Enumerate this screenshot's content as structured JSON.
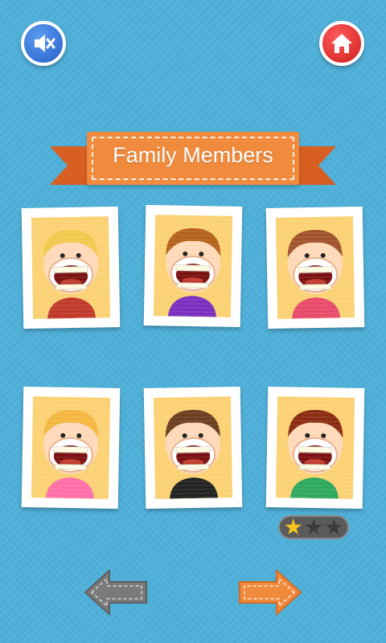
{
  "title": "Family Members",
  "buttons": {
    "sound": {
      "icon": "speaker-muted-icon",
      "color": "#1e58c6"
    },
    "home": {
      "icon": "home-icon",
      "color": "#d31f1f"
    }
  },
  "members": [
    {
      "id": "boy",
      "hair": "#f2c94c",
      "shirt": "#c0392b"
    },
    {
      "id": "big-brother",
      "hair": "#b4621b",
      "shirt": "#7b2fbf"
    },
    {
      "id": "girl",
      "hair": "#a0522d",
      "shirt": "#e84a6a"
    },
    {
      "id": "little-sister",
      "hair": "#f4b63f",
      "shirt": "#ff6fa8"
    },
    {
      "id": "father",
      "hair": "#6b3f1f",
      "shirt": "#222222"
    },
    {
      "id": "mother",
      "hair": "#8b2c12",
      "shirt": "#2ea85d"
    }
  ],
  "rating": {
    "filled": 1,
    "total": 3,
    "fill_color": "#f7c51f"
  },
  "navigation": {
    "prev": {
      "icon": "left-arrow-icon",
      "color": "#7a7a7a"
    },
    "next": {
      "icon": "right-arrow-icon",
      "color": "#f08a3c"
    }
  }
}
